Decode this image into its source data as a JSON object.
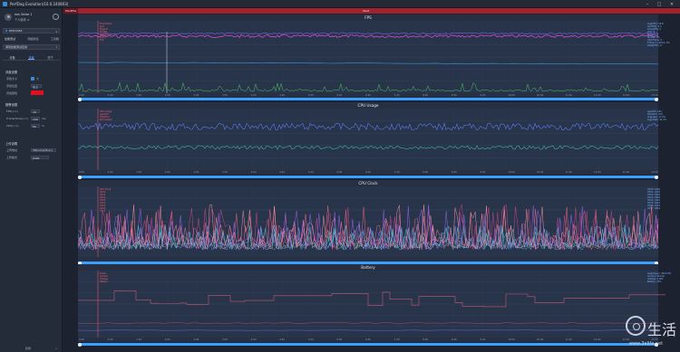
{
  "window": {
    "title": "PerfDog Evolution(10.0.240803)",
    "min_icon": "–",
    "max_icon": "□",
    "close_icon": "✕"
  },
  "sidebar": {
    "user_name": "ean Sellse 1",
    "user_org": "个人版本 ≡",
    "device": "RMX3366",
    "nav": [
      "性能测试",
      "网络测试",
      "工具箱"
    ],
    "app": "游戏性能测试应用",
    "tabs": [
      "设备",
      "设置",
      "关于"
    ],
    "active_tab": 1,
    "section_floating": "浮窗设置",
    "float_opts": [
      {
        "label": "浮窗大小",
        "value": "大"
      },
      {
        "label": "浮窗位置",
        "value": "左上"
      },
      {
        "label": "浮窗颜色",
        "value": ""
      }
    ],
    "section_alert": "报警设置",
    "alert_opts": [
      {
        "label": "FPS(<=)",
        "value": "18",
        "unit": ""
      },
      {
        "label": "FrameTime(>=)",
        "value": "100",
        "unit": "ms"
      },
      {
        "label": "CPU(>=)",
        "value": "80",
        "unit": "%"
      }
    ],
    "section_upload": "上传设置",
    "upload_opts": [
      {
        "label": "上传地址",
        "value": "https://perfdog.q"
      },
      {
        "label": "上传格式",
        "value": "JSON"
      }
    ],
    "footer_label": "折叠",
    "footer_icon": "«"
  },
  "main": {
    "start_tab": "StartFile",
    "center_label": "Start"
  },
  "time_ticks": [
    "0:00",
    "0:40",
    "1:20",
    "2:00",
    "2:40",
    "3:20",
    "4:00",
    "4:40",
    "5:20",
    "6:00",
    "6:40",
    "7:20",
    "8:00",
    "8:40",
    "9:20",
    "10:00",
    "10:40",
    "11:20",
    "12:00",
    "12:40",
    "13:20"
  ],
  "panels": [
    {
      "key": "fps",
      "title": "FPS",
      "legend_red": [
        "FrameTime",
        "Jank",
        "BigJank",
        "Stutter",
        "InterFrame",
        "Event",
        "FPS"
      ],
      "legend_right": [
        "Avg(FPS): 59.8",
        "Var(FPS): 0.4",
        "Drop(FPS): 0",
        "Jank: 0",
        "BigJank: 0",
        "Stutter: 0%",
        "InterFrame: 0",
        "FTime>=100ms: 0%",
        "Delta(FPS): 0"
      ]
    },
    {
      "key": "cpu",
      "title": "CPU Usage",
      "legend_red": [
        "CPU Usage",
        "AppCPU",
        "TotalCPU",
        "Normalized"
      ],
      "legend_right": [
        "AppCPU: 18%",
        "TotalCPU: 42%",
        "Avg(App): 17.6%",
        "Avg(Total): 41.2%"
      ]
    },
    {
      "key": "clock",
      "title": "CPU Clock",
      "legend_red": [
        "CPU Clock",
        "CPU0",
        "CPU1",
        "CPU2",
        "CPU3",
        "CPU4",
        "CPU5",
        "CPU6",
        "CPU7"
      ],
      "legend_right": [
        "CPU0: 1804",
        "CPU1: 1804",
        "CPU2: 1804",
        "CPU3: 1804",
        "CPU4: 2419",
        "CPU5: 2419",
        "CPU6: 2419",
        "CPU7: 2841"
      ]
    },
    {
      "key": "battery",
      "title": "Battery",
      "legend_red": [
        "Power",
        "Current",
        "Voltage",
        "Battery"
      ],
      "legend_right": [
        "Avg(Power): 3621mW",
        "Current: 912mA",
        "Voltage: 3.98V",
        "Battery: 74%"
      ]
    }
  ],
  "watermark": {
    "text": "生活",
    "url": "www.3elife.net"
  }
}
